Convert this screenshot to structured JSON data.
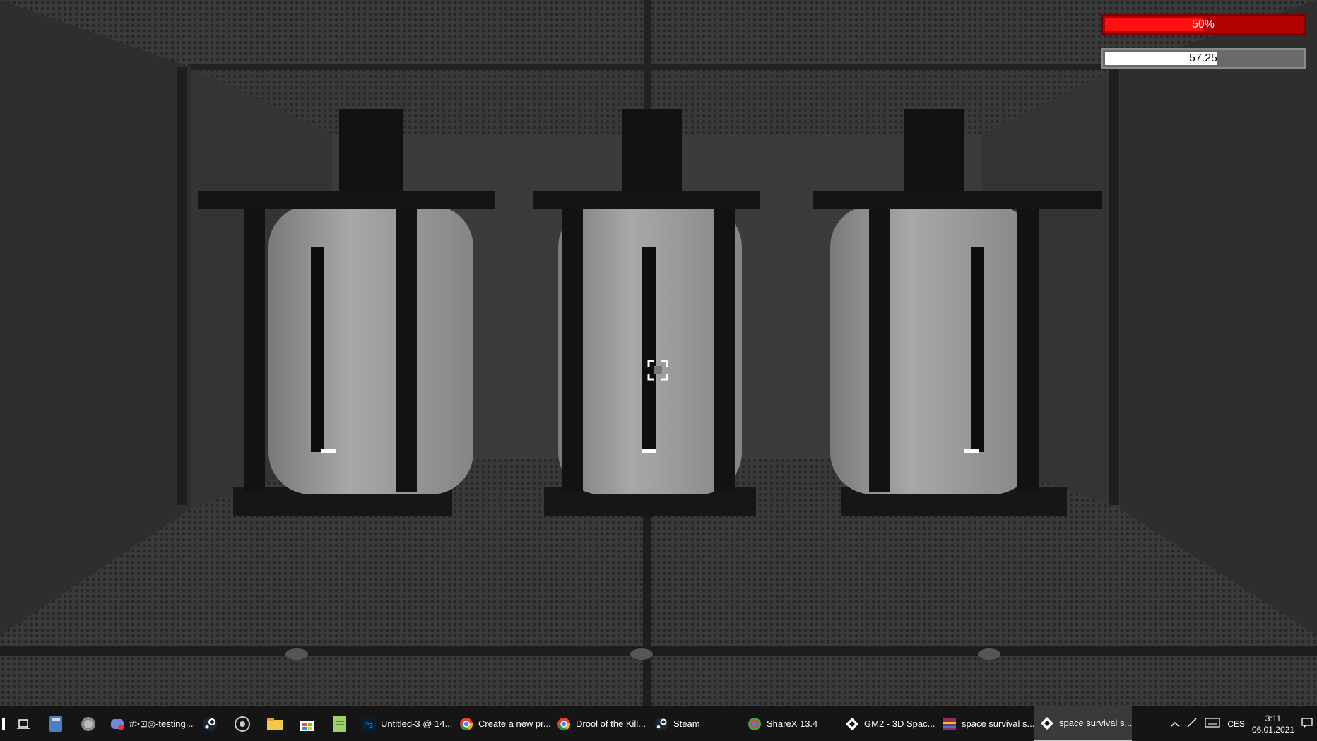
{
  "hud": {
    "health_label": "50%",
    "health_value": 0.5,
    "health_color": "#ff1010",
    "oxygen_label": "57.25",
    "oxygen_value": 0.57,
    "oxygen_color": "#ffffff"
  },
  "taskbar": {
    "tasks": [
      {
        "label": "#>⊡◎-testing...",
        "icon": "discord-icon"
      },
      {
        "label": "Untitled-3 @ 14...",
        "icon": "photoshop-icon"
      },
      {
        "label": "Create a new pr...",
        "icon": "chrome-icon"
      },
      {
        "label": "Drool of the Kill...",
        "icon": "chrome-icon"
      },
      {
        "label": "Steam",
        "icon": "steam-icon"
      },
      {
        "label": "ShareX 13.4",
        "icon": "sharex-icon"
      },
      {
        "label": "GM2 - 3D Spac...",
        "icon": "gamemaker-icon"
      },
      {
        "label": "space survival s...",
        "icon": "winrar-icon"
      },
      {
        "label": "space survival s...",
        "icon": "gamemaker-icon"
      }
    ],
    "tray": {
      "language": "CES",
      "time": "3:11",
      "date": "06.01.2021"
    }
  }
}
